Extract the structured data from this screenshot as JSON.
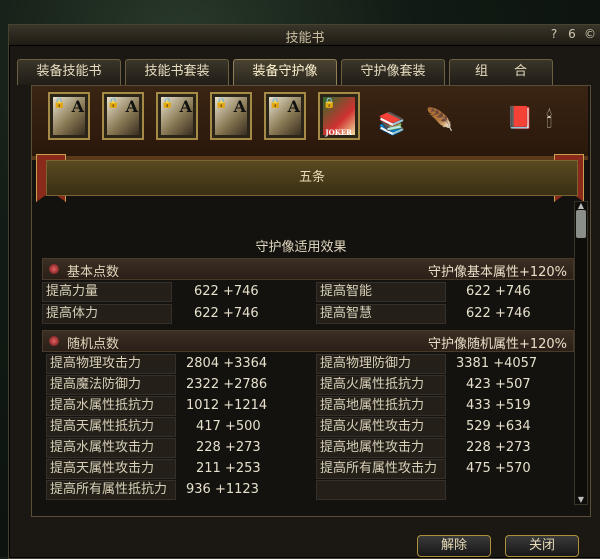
{
  "window": {
    "title": "技能书"
  },
  "titlebar_icons": {
    "help": "?",
    "settings": "6",
    "extra": "©"
  },
  "tabs": [
    {
      "label": "装备技能书"
    },
    {
      "label": "技能书套装"
    },
    {
      "label": "装备守护像",
      "active": true
    },
    {
      "label": "守护像套装"
    },
    {
      "label": "组　　合"
    }
  ],
  "cards": [
    {
      "letter": "A",
      "locked": true
    },
    {
      "letter": "A",
      "locked": true
    },
    {
      "letter": "A",
      "locked": true
    },
    {
      "letter": "A",
      "locked": true
    },
    {
      "letter": "A",
      "locked": true
    },
    {
      "letter": "JOKER",
      "locked": true
    }
  ],
  "banner": {
    "name": "五条"
  },
  "subheading": "守护像适用效果",
  "sections": {
    "basic": {
      "label": "基本点数",
      "bonus": "守护像基本属性+120%",
      "rows": [
        {
          "l_label": "提高力量",
          "l_value": "622 +746",
          "r_label": "提高智能",
          "r_value": "622 +746"
        },
        {
          "l_label": "提高体力",
          "l_value": "622 +746",
          "r_label": "提高智慧",
          "r_value": "622 +746"
        }
      ]
    },
    "random": {
      "label": "随机点数",
      "bonus": "守护像随机属性+120%",
      "rows": [
        {
          "l_label": "提高物理攻击力",
          "l_value": "2804 +3364",
          "r_label": "提高物理防御力",
          "r_value": "3381 +4057"
        },
        {
          "l_label": "提高魔法防御力",
          "l_value": "2322 +2786",
          "r_label": "提高火属性抵抗力",
          "r_value": "423 +507"
        },
        {
          "l_label": "提高水属性抵抗力",
          "l_value": "1012 +1214",
          "r_label": "提高地属性抵抗力",
          "r_value": "433 +519"
        },
        {
          "l_label": "提高天属性抵抗力",
          "l_value": "417 +500",
          "r_label": "提高火属性攻击力",
          "r_value": "529 +634"
        },
        {
          "l_label": "提高水属性攻击力",
          "l_value": "228 +273",
          "r_label": "提高地属性攻击力",
          "r_value": "228 +273"
        },
        {
          "l_label": "提高天属性攻击力",
          "l_value": "211 +253",
          "r_label": "提高所有属性攻击力",
          "r_value": "475 +570"
        },
        {
          "l_label": "提高所有属性抵抗力",
          "l_value": "936 +1123",
          "r_label": "",
          "r_value": ""
        }
      ]
    }
  },
  "buttons": {
    "remove": "解除",
    "close": "关闭"
  }
}
